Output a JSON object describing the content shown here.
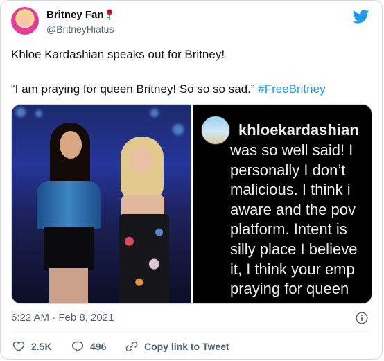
{
  "header": {
    "display_name": "Britney Fan",
    "handle": "@BritneyHiatus"
  },
  "tweet": {
    "line1": "Khloe Kardashian speaks out for Britney!",
    "line2_text": "“I am praying for queen Britney! So so so sad.”",
    "hashtag": "#FreeBritney"
  },
  "media": {
    "instagram": {
      "username": "khloekardashian",
      "caption_lines": [
        "was so well said! I",
        "personally I don’t",
        "malicious. I think i",
        "aware and the pov",
        "platform. Intent is",
        "silly place I believe",
        "it, I think your emp",
        "praying for queen"
      ]
    }
  },
  "meta": {
    "timestamp": "6:22 AM · Feb 8, 2021"
  },
  "actions": {
    "likes": "2.5K",
    "replies": "496",
    "copy_link": "Copy link to Tweet"
  },
  "colors": {
    "accent": "#1d9bf0",
    "text": "#0f1419",
    "muted": "#536471"
  }
}
